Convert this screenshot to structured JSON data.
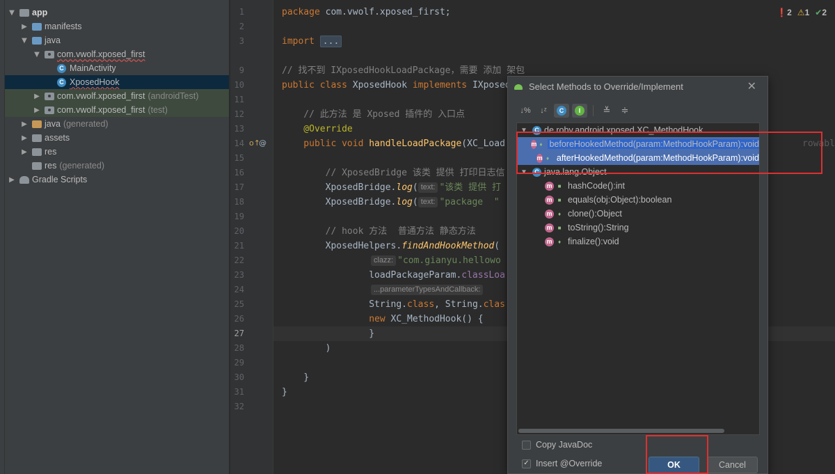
{
  "project_tree": [
    {
      "label": "app",
      "suffix": "",
      "icon": "module-folder-icon",
      "arrow": "down"
    },
    {
      "label": "manifests",
      "suffix": "",
      "icon": "folder-icon",
      "arrow": "right"
    },
    {
      "label": "java",
      "suffix": "",
      "icon": "folder-icon",
      "arrow": "down"
    },
    {
      "label": "com.vwolf.xposed_first",
      "suffix": "",
      "icon": "package-icon",
      "arrow": "down"
    },
    {
      "label": "MainActivity",
      "suffix": "",
      "icon": "class-icon",
      "arrow": ""
    },
    {
      "label": "XposedHook",
      "suffix": "",
      "icon": "class-icon",
      "arrow": ""
    },
    {
      "label": "com.vwolf.xposed_first",
      "suffix": "(androidTest)",
      "icon": "package-icon",
      "arrow": "right"
    },
    {
      "label": "com.vwolf.xposed_first",
      "suffix": "(test)",
      "icon": "package-icon",
      "arrow": "right"
    },
    {
      "label": "java",
      "suffix": "(generated)",
      "icon": "folder-icon",
      "arrow": "right"
    },
    {
      "label": "assets",
      "suffix": "",
      "icon": "folder-icon",
      "arrow": "right"
    },
    {
      "label": "res",
      "suffix": "",
      "icon": "folder-icon",
      "arrow": "right"
    },
    {
      "label": "res",
      "suffix": "(generated)",
      "icon": "folder-icon",
      "arrow": ""
    },
    {
      "label": "Gradle Scripts",
      "suffix": "",
      "icon": "gradle-icon",
      "arrow": "right"
    }
  ],
  "editor": {
    "line_numbers": [
      "1",
      "2",
      "3",
      "9",
      "10",
      "11",
      "12",
      "13",
      "14",
      "15",
      "16",
      "17",
      "18",
      "19",
      "20",
      "21",
      "22",
      "23",
      "24",
      "25",
      "26",
      "27",
      "28",
      "29",
      "30",
      "31",
      "32"
    ],
    "current_line": "27",
    "code": {
      "l1_kw": "package",
      "l1_rest": " com.vwolf.xposed_first;",
      "l3_kw": "import",
      "l3_fold": "...",
      "l9": "// 找不到 IXposedHookLoadPackage，需要 添加 架包",
      "l10_kw1": "public class",
      "l10_mid": " XposedHook ",
      "l10_kw2": "implements",
      "l10_rest": " IXposed",
      "l12": "    // 此方法 是 Xposed 插件的 入口点",
      "l13": "    @Override",
      "l14_kw": "    public void ",
      "l14_fn": "handleLoadPackage",
      "l14_rest": "(XC_Load",
      "l14_tail": "rowable",
      "l16": "        // XposedBridge 该类 提供 打印日志信",
      "l17_a": "        XposedBridge.",
      "l17_fn": "log",
      "l17_b": "(",
      "l17_hint": "text:",
      "l17_str": "\"该类 提供 打",
      "l18_a": "        XposedBridge.",
      "l18_fn": "log",
      "l18_b": "(",
      "l18_hint": "text:",
      "l18_str": "\"package  \"",
      "l20": "        // hook 方法  普通方法 静态方法",
      "l21_a": "        XposedHelpers.",
      "l21_fn": "findAndHookMethod",
      "l21_b": "(",
      "l22_hint": "clazz:",
      "l22_str": "\"com.gianyu.hellowo",
      "l23_a": "                loadPackageParam.",
      "l23_fd": "classLoa",
      "l24_hint": "...parameterTypesAndCallback:",
      "l25_a": "                String.",
      "l25_kw1": "class",
      "l25_b": ", String.",
      "l25_kw2": "clas",
      "l26_kw": "                new",
      "l26_rest": " XC_MethodHook() {",
      "l27": "                }",
      "l28": "        )",
      "l30": "    }",
      "l31": "}"
    },
    "inspections": {
      "errors": "2",
      "warnings": "1",
      "ok": "2"
    }
  },
  "dialog": {
    "title": "Select Methods to Override/Implement",
    "toolbar": [
      "sort-by-visibility",
      "sort-alpha",
      "show-classes",
      "show-interfaces",
      "expand-all",
      "collapse-all"
    ],
    "groups": [
      {
        "name": "de.robv.android.xposed.XC_MethodHook",
        "methods": [
          "beforeHookedMethod(param:MethodHookParam):void",
          "afterHookedMethod(param:MethodHookParam):void"
        ]
      },
      {
        "name": "java.lang.Object",
        "methods": [
          "hashCode():int",
          "equals(obj:Object):boolean",
          "clone():Object",
          "toString():String",
          "finalize():void"
        ]
      }
    ],
    "copy_javadoc": "Copy JavaDoc",
    "insert_override": "Insert @Override",
    "copy_javadoc_checked": false,
    "insert_override_checked": true,
    "ok_label": "OK",
    "cancel_label": "Cancel"
  },
  "colors": {
    "highlight": "#e02f2f",
    "selection": "#2f65ca",
    "accent": "#365880"
  }
}
